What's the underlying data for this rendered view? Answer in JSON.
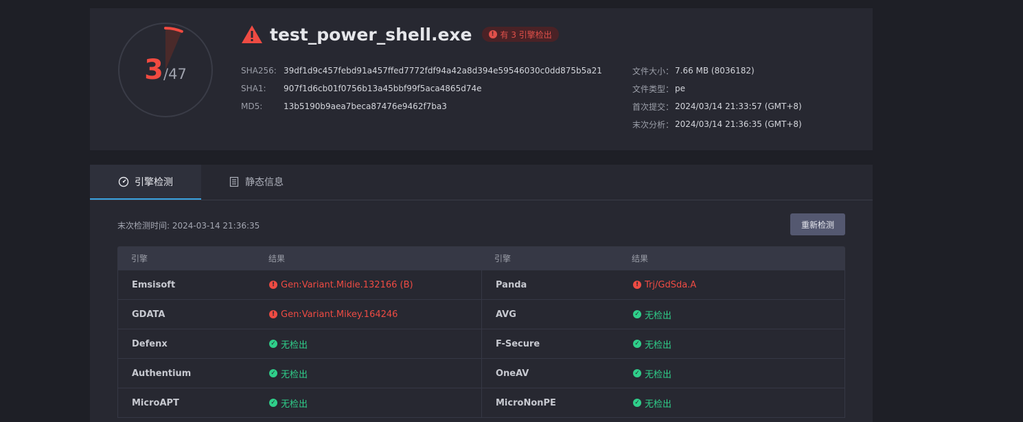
{
  "summary": {
    "score": "3",
    "total": "/47",
    "detected": 3,
    "engines_total": 47,
    "file_name": "test_power_shell.exe",
    "badge": "有 3 引擎检出",
    "hashes": [
      {
        "key": "SHA256:",
        "value": "39df1d9c457febd91a457ffed7772fdf94a42a8d394e59546030c0dd875b5a21"
      },
      {
        "key": "SHA1:",
        "value": "907f1d6cb01f0756b13a45bbf99f5aca4865d74e"
      },
      {
        "key": "MD5:",
        "value": "13b5190b9aea7beca87476e9462f7ba3"
      }
    ],
    "meta": [
      {
        "key": "文件大小：",
        "value": "7.66 MB (8036182)"
      },
      {
        "key": "文件类型：",
        "value": "pe"
      },
      {
        "key": "首次提交：",
        "value": "2024/03/14 21:33:57 (GMT+8)"
      },
      {
        "key": "末次分析：",
        "value": "2024/03/14 21:36:35 (GMT+8)"
      }
    ]
  },
  "tabs": [
    {
      "label": "引擎检测",
      "icon": "gauge-icon",
      "active": true
    },
    {
      "label": "静态信息",
      "icon": "document-icon",
      "active": false
    }
  ],
  "scan": {
    "last_time": "末次检测时间: 2024-03-14 21:36:35",
    "rescan_label": "重新检测"
  },
  "table": {
    "headers": [
      "引擎",
      "结果",
      "引擎",
      "结果"
    ],
    "rows": [
      {
        "left": {
          "engine": "Emsisoft",
          "result": "Gen:Variant.Midie.132166 (B)",
          "status": "bad"
        },
        "right": {
          "engine": "Panda",
          "result": "Trj/GdSda.A",
          "status": "bad"
        }
      },
      {
        "left": {
          "engine": "GDATA",
          "result": "Gen:Variant.Mikey.164246",
          "status": "bad"
        },
        "right": {
          "engine": "AVG",
          "result": "无检出",
          "status": "ok"
        }
      },
      {
        "left": {
          "engine": "Defenx",
          "result": "无检出",
          "status": "ok"
        },
        "right": {
          "engine": "F-Secure",
          "result": "无检出",
          "status": "ok"
        }
      },
      {
        "left": {
          "engine": "Authentium",
          "result": "无检出",
          "status": "ok"
        },
        "right": {
          "engine": "OneAV",
          "result": "无检出",
          "status": "ok"
        }
      },
      {
        "left": {
          "engine": "MicroAPT",
          "result": "无检出",
          "status": "ok"
        },
        "right": {
          "engine": "MicroNonPE",
          "result": "无检出",
          "status": "ok"
        }
      }
    ]
  },
  "colors": {
    "danger": "#ee4b43",
    "safe": "#2fcf8a",
    "accent": "#3aa3e0"
  }
}
